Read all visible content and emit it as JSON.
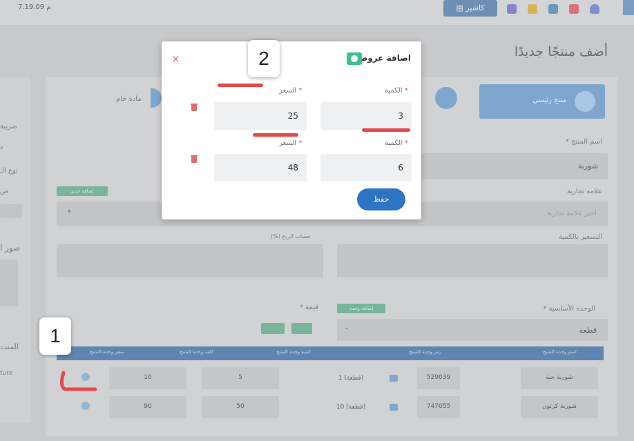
{
  "topbar": {
    "date": "7.19.09 م",
    "cashier_label": "كاشير"
  },
  "page": {
    "title": "أضف منتجًا جديدًا"
  },
  "form": {
    "product_type_active": "منتج رئيسي",
    "product_type_other": "مادة خام",
    "product_name_label": "اسم المنتج *",
    "product_name_value": "شوربة",
    "brand_label": "علامة تجارية",
    "brand_placeholder": "اختر علامة تجارية",
    "brand_add": "إضافة جديد",
    "qty_pricing_label": "التسعير بالكمية",
    "profit_label": "حساب الربح (%)",
    "base_unit_label": "الوحدة الأساسية *",
    "base_unit_value": "قطعة",
    "base_unit_add": "إضافة وحدة",
    "value_label": "قيمة *",
    "left_labels": [
      "ضريبة",
      "د",
      "نوع الـ",
      "ص",
      "صور ا",
      "المنت",
      "ture"
    ]
  },
  "table": {
    "headers": [
      "اسم وحدة المنتج",
      "رمز وحدة المنتج",
      "كمية وحدة المنتج",
      "كلفة وحدة المنتج",
      "سعر وحدة المنتج"
    ],
    "rows": [
      {
        "name": "شوربة حبة",
        "code": "529039",
        "unit_qty": "1 (قطعة)",
        "cost": "5",
        "price": "10"
      },
      {
        "name": "شوربة كرتون",
        "code": "747055",
        "unit_qty": "10 (قطعة)",
        "cost": "50",
        "price": "90"
      }
    ]
  },
  "modal": {
    "title": "اضافة عروض",
    "qty_label": "الكمية",
    "price_label": "السعر",
    "required_mark": "*",
    "close_symbol": "×",
    "rows": [
      {
        "qty": "3",
        "price": "25"
      },
      {
        "qty": "6",
        "price": "48"
      }
    ],
    "save_label": "حفظ"
  },
  "annotations": {
    "callout_1": "1",
    "callout_2": "2"
  },
  "colors": {
    "accent": "#2d74c4",
    "success": "#3cc08f",
    "danger": "#e5484d"
  }
}
